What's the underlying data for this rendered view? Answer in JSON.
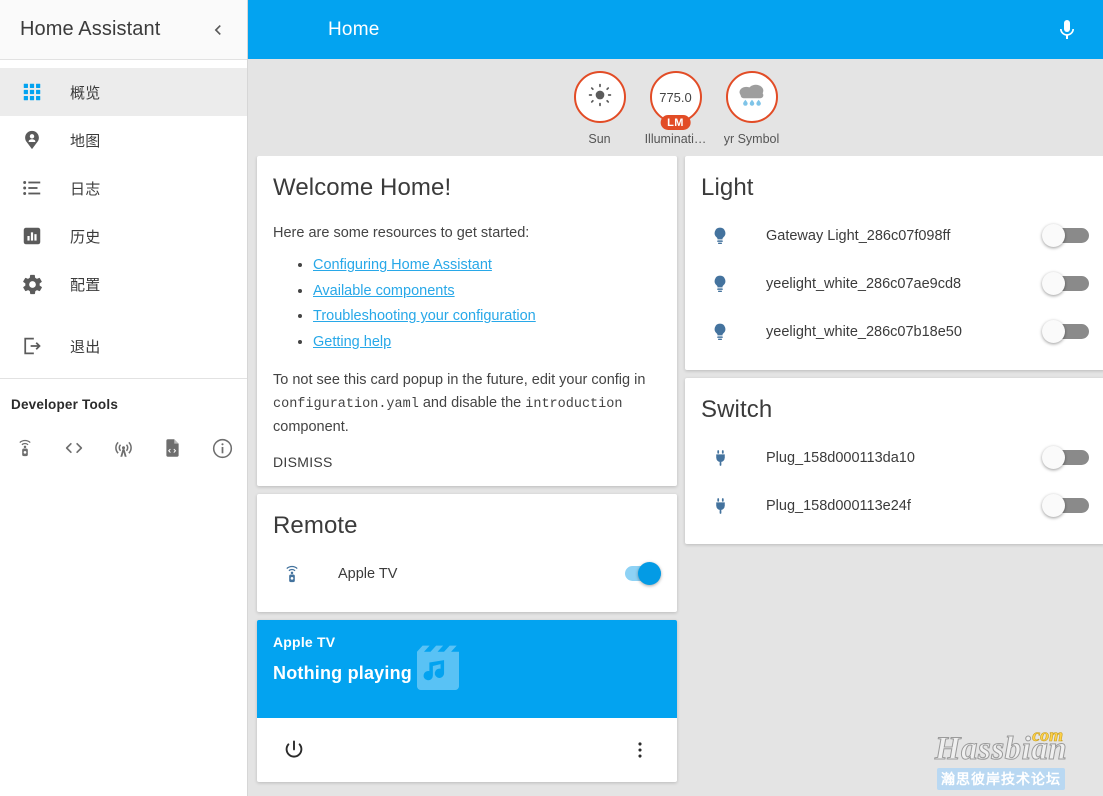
{
  "sidebar": {
    "title": "Home Assistant",
    "collapse_icon": "chevron-left-icon",
    "items": [
      {
        "label": "概览",
        "icon": "view-dashboard-icon",
        "selected": true
      },
      {
        "label": "地图",
        "icon": "map-marker-account-icon",
        "selected": false
      },
      {
        "label": "日志",
        "icon": "format-list-bulleted-icon",
        "selected": false
      },
      {
        "label": "历史",
        "icon": "chart-box-icon",
        "selected": false
      },
      {
        "label": "配置",
        "icon": "cog-icon",
        "selected": false
      },
      {
        "label": "退出",
        "icon": "exit-to-app-icon",
        "selected": false
      }
    ],
    "developer_tools": {
      "title": "Developer Tools",
      "icons": [
        "remote-icon",
        "code-tags-icon",
        "broadcast-tower-icon",
        "file-code-icon",
        "information-outline-icon"
      ]
    }
  },
  "toolbar": {
    "title": "Home",
    "mic_icon": "microphone-icon",
    "accent_color": "#03a3f0"
  },
  "badges": [
    {
      "name": "Sun",
      "value": "",
      "unit": "",
      "icon": "weather-sunny-icon",
      "border_color": "#e24c26"
    },
    {
      "name": "Illuminati…",
      "value": "775.0",
      "unit": "LM",
      "icon": "",
      "border_color": "#e24c26"
    },
    {
      "name": "yr Symbol",
      "value": "",
      "unit": "",
      "icon": "weather-rainy-icon",
      "border_color": "#e24c26"
    }
  ],
  "cards": {
    "intro": {
      "title": "Welcome Home!",
      "lead": "Here are some resources to get started:",
      "links": [
        "Configuring Home Assistant",
        "Available components",
        "Troubleshooting your configuration",
        "Getting help"
      ],
      "note_before": "To not see this card popup in the future, edit your config in ",
      "note_code_1": "configuration.yaml",
      "note_middle": " and disable the ",
      "note_code_2": "introduction",
      "note_after": " component.",
      "dismiss_label": "DISMISS",
      "link_color": "#28a8e8"
    },
    "remote": {
      "title": "Remote",
      "entities": [
        {
          "name": "Apple TV",
          "icon": "remote-icon",
          "state": "on"
        }
      ]
    },
    "media_player": {
      "title": "Apple TV",
      "state": "Nothing playing",
      "art_icon": "movie-music-icon",
      "power_icon": "power-icon",
      "more_icon": "dots-vertical-icon",
      "header_color": "#03a3f0"
    },
    "light": {
      "title": "Light",
      "entities": [
        {
          "name": "Gateway Light_286c07f098ff",
          "icon": "lightbulb-icon",
          "state": "off"
        },
        {
          "name": "yeelight_white_286c07ae9cd8",
          "icon": "lightbulb-icon",
          "state": "off"
        },
        {
          "name": "yeelight_white_286c07b18e50",
          "icon": "lightbulb-icon",
          "state": "off"
        }
      ]
    },
    "switch": {
      "title": "Switch",
      "entities": [
        {
          "name": "Plug_158d000113da10",
          "icon": "power-plug-icon",
          "state": "off"
        },
        {
          "name": "Plug_158d000113e24f",
          "icon": "power-plug-icon",
          "state": "off"
        }
      ]
    }
  },
  "watermark": {
    "brand": "Hassbian",
    "tld": "com",
    "subtitle": "瀚思彼岸技术论坛"
  }
}
